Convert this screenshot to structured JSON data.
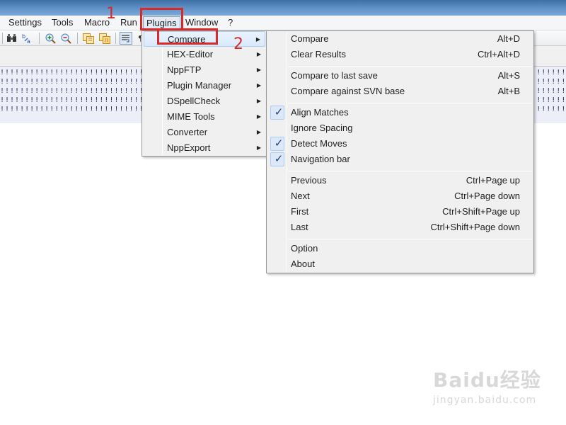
{
  "menubar": {
    "items": [
      "Settings",
      "Tools",
      "Macro",
      "Run",
      "Plugins",
      "Window",
      "?"
    ],
    "active": "Plugins"
  },
  "toolbar": {
    "icons": [
      "find-icon",
      "replace-icon",
      "zoom-in-icon",
      "zoom-out-icon",
      "sync-vertical-icon",
      "sync-horizontal-icon",
      "word-wrap-icon",
      "show-all-chars-icon"
    ]
  },
  "editor": {
    "row_text": "!!!!!!!!!!!!!!!!!!!!!!!!!!!!!!!!!!!!!!!!!!!!!!!!!!!!!!!!!!!!!!!!!!!!!!!!!!!!!!!!!!!!!!!!!!!!!!!!!!!!!!!!!!!!!!!!!!!!"
  },
  "plugins_menu": {
    "items": [
      "Compare",
      "HEX-Editor",
      "NppFTP",
      "Plugin Manager",
      "DSpellCheck",
      "MIME Tools",
      "Converter",
      "NppExport"
    ],
    "highlighted": "Compare"
  },
  "compare_menu": {
    "groups": [
      [
        {
          "label": "Compare",
          "shortcut": "Alt+D"
        },
        {
          "label": "Clear Results",
          "shortcut": "Ctrl+Alt+D"
        }
      ],
      [
        {
          "label": "Compare to last save",
          "shortcut": "Alt+S"
        },
        {
          "label": "Compare against SVN base",
          "shortcut": "Alt+B"
        }
      ],
      [
        {
          "label": "Align Matches",
          "shortcut": "",
          "checked": true
        },
        {
          "label": "Ignore Spacing",
          "shortcut": "",
          "checked": false
        },
        {
          "label": "Detect Moves",
          "shortcut": "",
          "checked": true
        },
        {
          "label": "Navigation bar",
          "shortcut": "",
          "checked": true
        }
      ],
      [
        {
          "label": "Previous",
          "shortcut": "Ctrl+Page up"
        },
        {
          "label": "Next",
          "shortcut": "Ctrl+Page down"
        },
        {
          "label": "First",
          "shortcut": "Ctrl+Shift+Page up"
        },
        {
          "label": "Last",
          "shortcut": "Ctrl+Shift+Page down"
        }
      ],
      [
        {
          "label": "Option",
          "shortcut": ""
        },
        {
          "label": "About",
          "shortcut": ""
        }
      ]
    ],
    "check_glyph": "✓"
  },
  "annotations": {
    "step1": "1",
    "step2": "2",
    "color": "#d92a2a"
  },
  "watermark": {
    "logo": "Baidu经验",
    "url": "jingyan.baidu.com"
  }
}
